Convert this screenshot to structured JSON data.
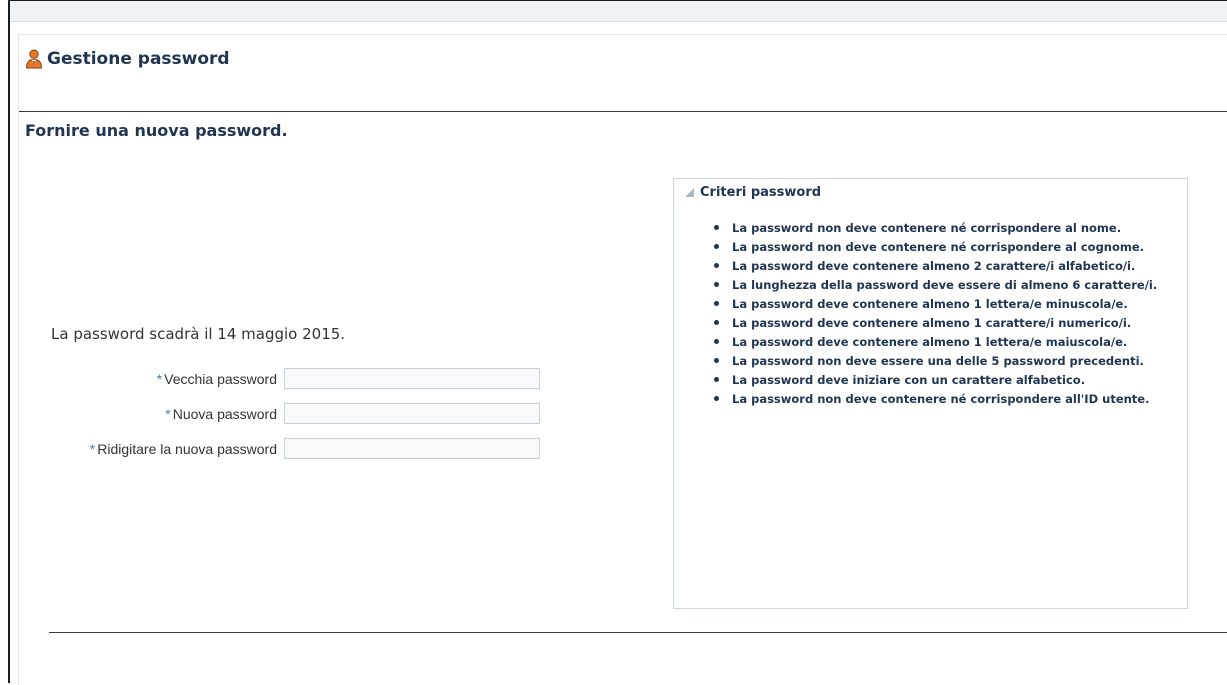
{
  "header": {
    "title": "Gestione password",
    "icon": "user-icon"
  },
  "subheader": "Fornire una nuova password.",
  "expire_text": "La password scadrà il 14 maggio 2015.",
  "form": {
    "required_mark": "*",
    "fields": [
      {
        "label": "Vecchia password",
        "value": "",
        "placeholder": ""
      },
      {
        "label": "Nuova password",
        "value": "",
        "placeholder": ""
      },
      {
        "label": "Ridigitare la nuova password",
        "value": "",
        "placeholder": ""
      }
    ]
  },
  "criteria": {
    "title": "Criteri password",
    "items": [
      "La password non deve contenere né corrispondere al nome.",
      "La password non deve contenere né corrispondere al cognome.",
      "La password deve contenere almeno 2 carattere/i alfabetico/i.",
      "La lunghezza della password deve essere di almeno 6 carattere/i.",
      "La password deve contenere almeno 1 lettera/e minuscola/e.",
      "La password deve contenere almeno 1 carattere/i numerico/i.",
      "La password deve contenere almeno 1 lettera/e maiuscola/e.",
      "La password non deve essere una delle 5 password precedenti.",
      "La password deve iniziare con un carattere alfabetico.",
      "La password non deve contenere né corrispondere all'ID utente."
    ]
  },
  "colors": {
    "heading": "#1f3551",
    "required": "#4a7fb5",
    "input_border": "#c7cfd6",
    "icon_orange": "#e8762b"
  }
}
